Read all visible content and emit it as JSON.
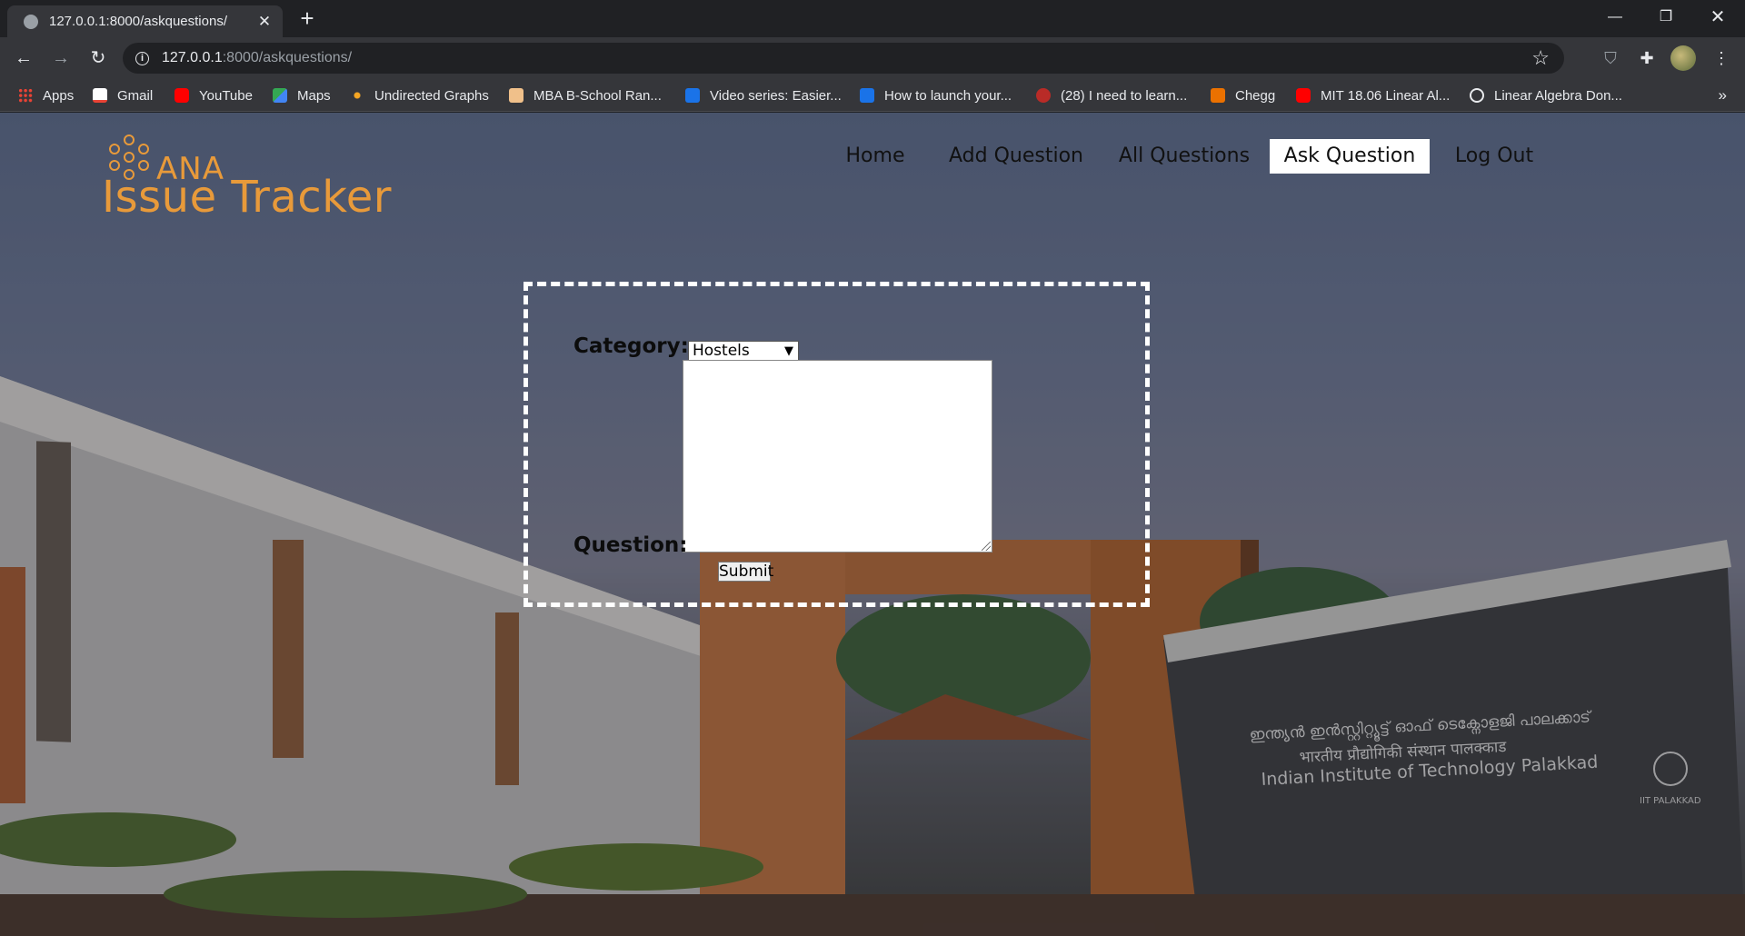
{
  "browser": {
    "tab_title": "127.0.0.1:8000/askquestions/",
    "url_host": "127.0.0.1",
    "url_path": ":8000/askquestions/",
    "bookmarks": [
      {
        "label": "Apps",
        "icon": "apps-grid-icon",
        "color": "#ea4335"
      },
      {
        "label": "Gmail",
        "icon": "gmail-icon",
        "color": "#ea4335"
      },
      {
        "label": "YouTube",
        "icon": "youtube-icon",
        "color": "#ff0000"
      },
      {
        "label": "Maps",
        "icon": "maps-icon",
        "color": "#34a853"
      },
      {
        "label": "Undirected Graphs",
        "icon": "graph-icon",
        "color": "#f5a623"
      },
      {
        "label": "MBA B-School Ran...",
        "icon": "page-icon",
        "color": "#f0c08a"
      },
      {
        "label": "Video series: Easier...",
        "icon": "doc-icon",
        "color": "#1a73e8"
      },
      {
        "label": "How to launch your...",
        "icon": "doc-icon",
        "color": "#1a73e8"
      },
      {
        "label": "(28) I need to learn...",
        "icon": "quora-icon",
        "color": "#b92b27"
      },
      {
        "label": "Chegg",
        "icon": "chegg-icon",
        "color": "#eb7100"
      },
      {
        "label": "MIT 18.06 Linear Al...",
        "icon": "youtube-icon",
        "color": "#ff0000"
      },
      {
        "label": "Linear Algebra Don...",
        "icon": "globe-icon",
        "color": "#e8eaed"
      }
    ],
    "more_bookmarks": "»"
  },
  "site": {
    "logo_small": "ANA",
    "logo_main": "Issue Tracker",
    "accent_color": "#e89a3a",
    "nav": [
      {
        "label": "Home",
        "active": false
      },
      {
        "label": "Add Question",
        "active": false
      },
      {
        "label": "All Questions",
        "active": false
      },
      {
        "label": "Ask Question",
        "active": true
      },
      {
        "label": "Log Out",
        "active": false
      }
    ]
  },
  "form": {
    "category_label": "Category:",
    "category_value": "Hostels",
    "question_label": "Question:",
    "question_value": "",
    "submit_label": "Submit"
  },
  "background": {
    "banner_line1": "ഇന്ത്യൻ ഇൻസ്റ്റിറ്റ്യൂട്ട് ഓഫ് ടെക്നോളജി പാലക്കാട്",
    "banner_line2": "भारतीय प्रौद्योगिकी संस्थान पालक्काड",
    "banner_line3": "Indian Institute of Technology Palakkad",
    "emblem_text": "IIT PALAKKAD"
  }
}
